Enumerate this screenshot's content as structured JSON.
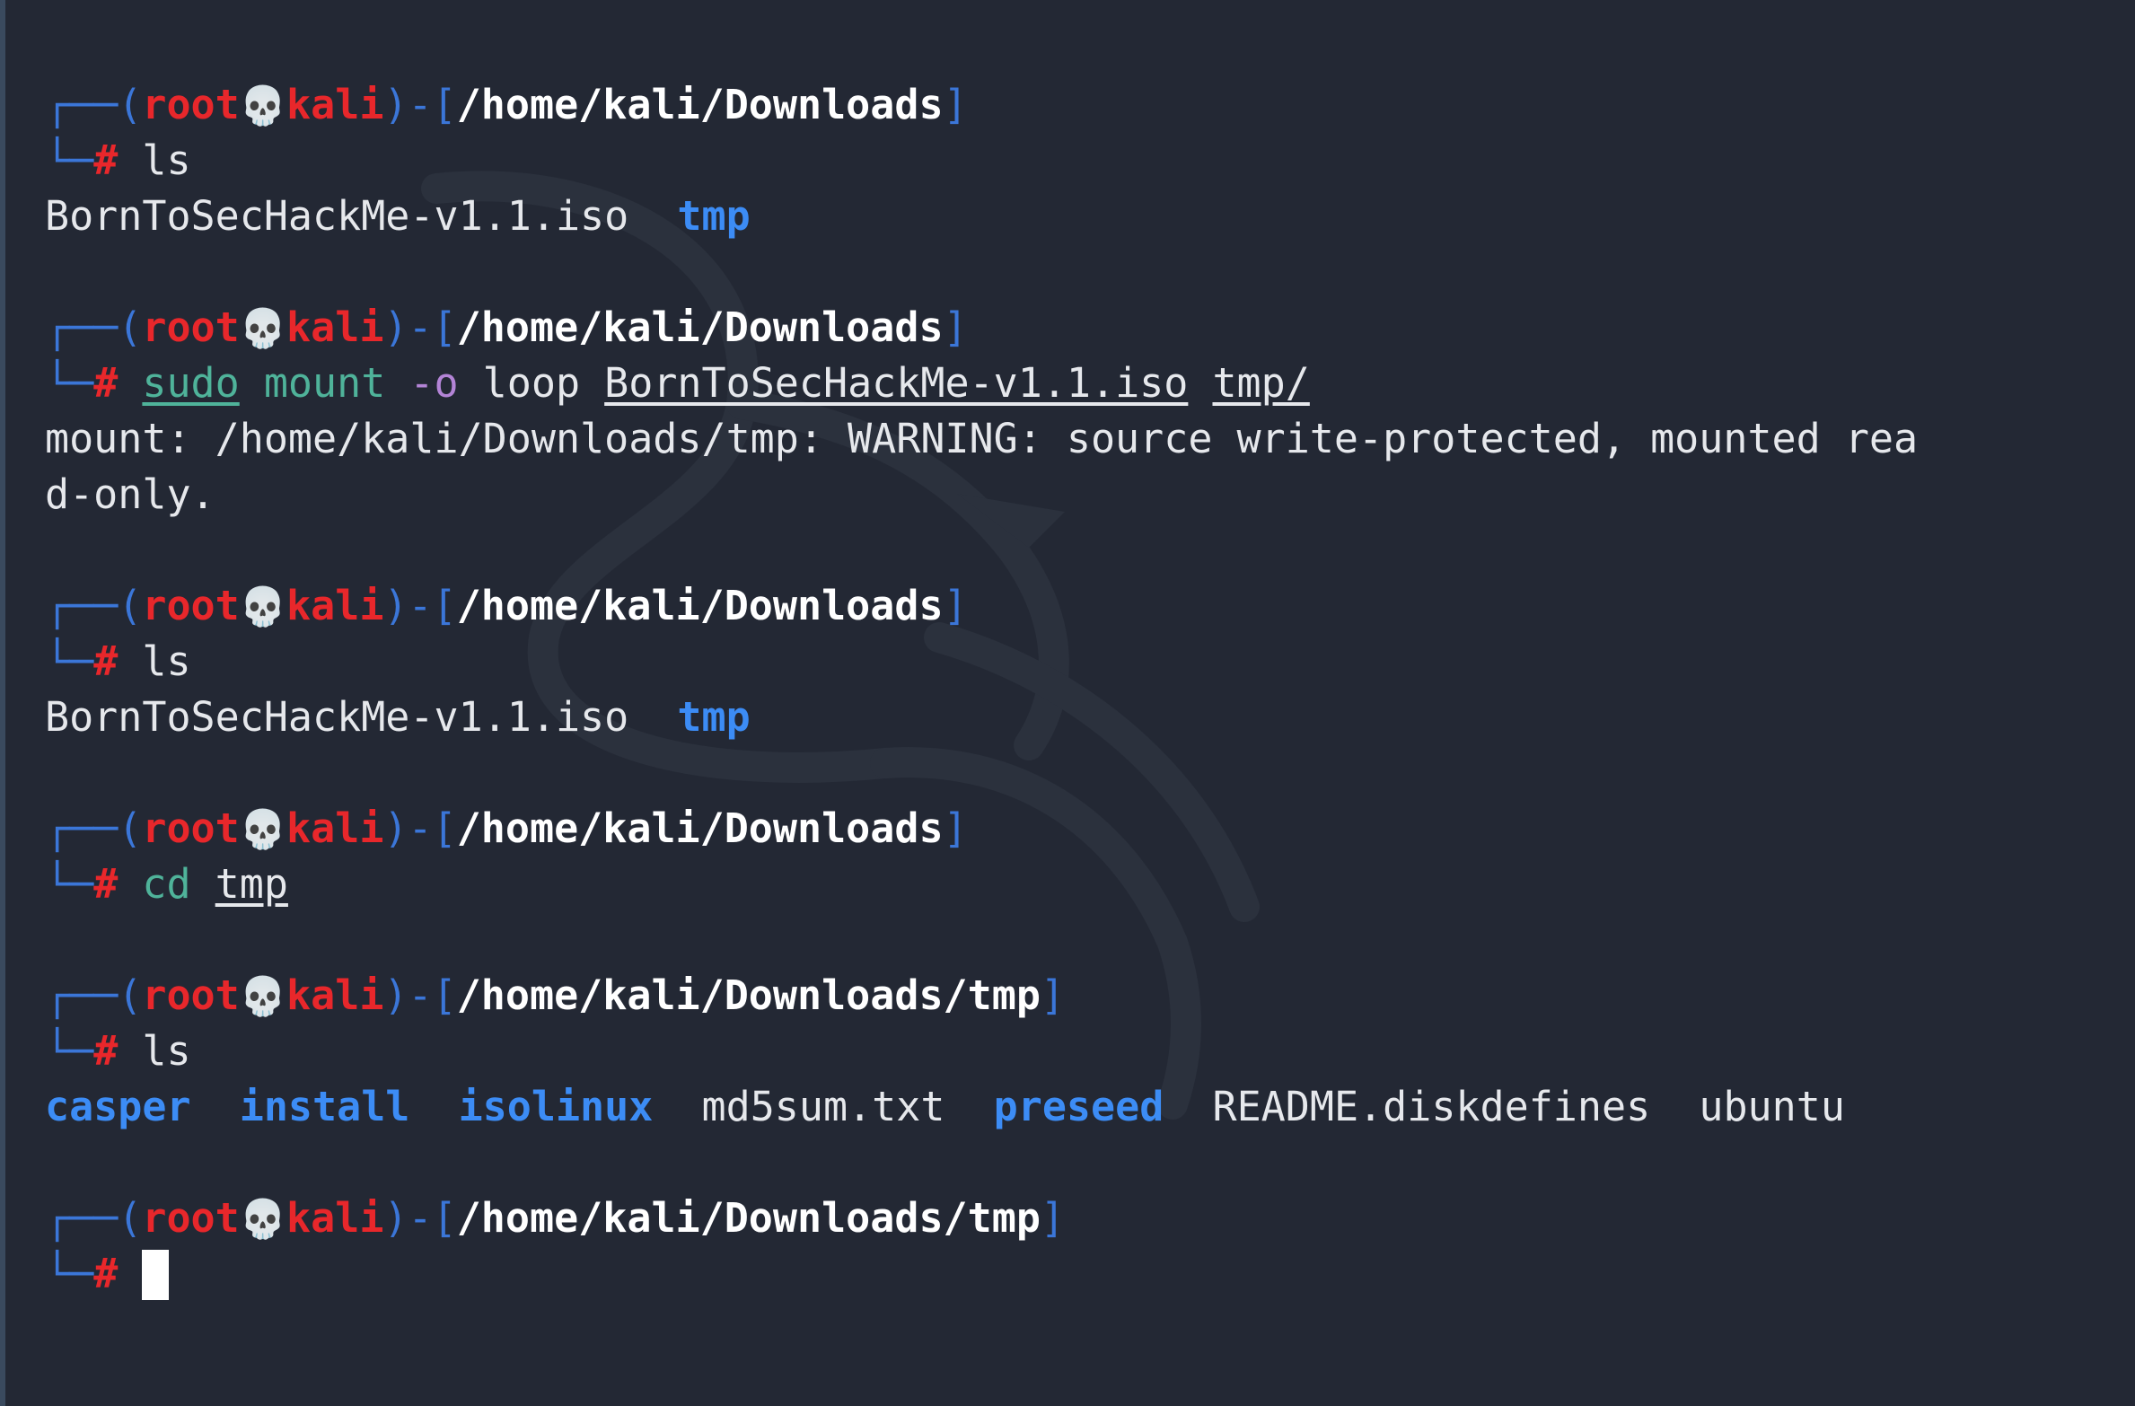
{
  "prompt": {
    "user": "root",
    "skull": "💀",
    "host": "kali",
    "hash": "#"
  },
  "blocks": [
    {
      "path": "/home/kali/Downloads",
      "command": {
        "parts": [
          {
            "t": "ls",
            "cls": "cmd-white"
          }
        ]
      },
      "output": [
        {
          "items": [
            {
              "t": "BornToSecHackMe-v1.1.iso",
              "type": "file"
            },
            {
              "t": "tmp",
              "type": "dir"
            }
          ]
        }
      ]
    },
    {
      "path": "/home/kali/Downloads",
      "command": {
        "parts": [
          {
            "t": "sudo",
            "cls": "cmd-green u"
          },
          {
            "t": " ",
            "cls": "cmd-white"
          },
          {
            "t": "mount",
            "cls": "cmd-green"
          },
          {
            "t": " ",
            "cls": "cmd-white"
          },
          {
            "t": "-o",
            "cls": "flag"
          },
          {
            "t": " loop ",
            "cls": "cmd-white"
          },
          {
            "t": "BornToSecHackMe-v1.1.iso",
            "cls": "cmd-white u"
          },
          {
            "t": " ",
            "cls": "cmd-white"
          },
          {
            "t": "tmp/",
            "cls": "cmd-white u"
          }
        ]
      },
      "output": [
        {
          "text": "mount: /home/kali/Downloads/tmp: WARNING: source write-protected, mounted rea"
        },
        {
          "text": "d-only."
        }
      ]
    },
    {
      "path": "/home/kali/Downloads",
      "command": {
        "parts": [
          {
            "t": "ls",
            "cls": "cmd-white"
          }
        ]
      },
      "output": [
        {
          "items": [
            {
              "t": "BornToSecHackMe-v1.1.iso",
              "type": "file"
            },
            {
              "t": "tmp",
              "type": "dir"
            }
          ]
        }
      ]
    },
    {
      "path": "/home/kali/Downloads",
      "command": {
        "parts": [
          {
            "t": "cd",
            "cls": "cmd-green"
          },
          {
            "t": " ",
            "cls": "cmd-white"
          },
          {
            "t": "tmp",
            "cls": "cmd-white u"
          }
        ]
      },
      "output": []
    },
    {
      "path": "/home/kali/Downloads/tmp",
      "command": {
        "parts": [
          {
            "t": "ls",
            "cls": "cmd-white"
          }
        ]
      },
      "output": [
        {
          "items": [
            {
              "t": "casper",
              "type": "dir"
            },
            {
              "t": "install",
              "type": "dir"
            },
            {
              "t": "isolinux",
              "type": "dir"
            },
            {
              "t": "md5sum.txt",
              "type": "file"
            },
            {
              "t": "preseed",
              "type": "dir"
            },
            {
              "t": "README.diskdefines",
              "type": "file"
            },
            {
              "t": "ubuntu",
              "type": "file"
            }
          ]
        }
      ]
    },
    {
      "path": "/home/kali/Downloads/tmp",
      "command": null,
      "output": [],
      "cursor": true
    }
  ],
  "colors": {
    "background": "#232834",
    "prompt_box": "#3b76d8",
    "prompt_user": "#e8272b",
    "directory": "#3c8cf5",
    "command_builtin": "#4fb39a",
    "flag": "#b384d6"
  }
}
